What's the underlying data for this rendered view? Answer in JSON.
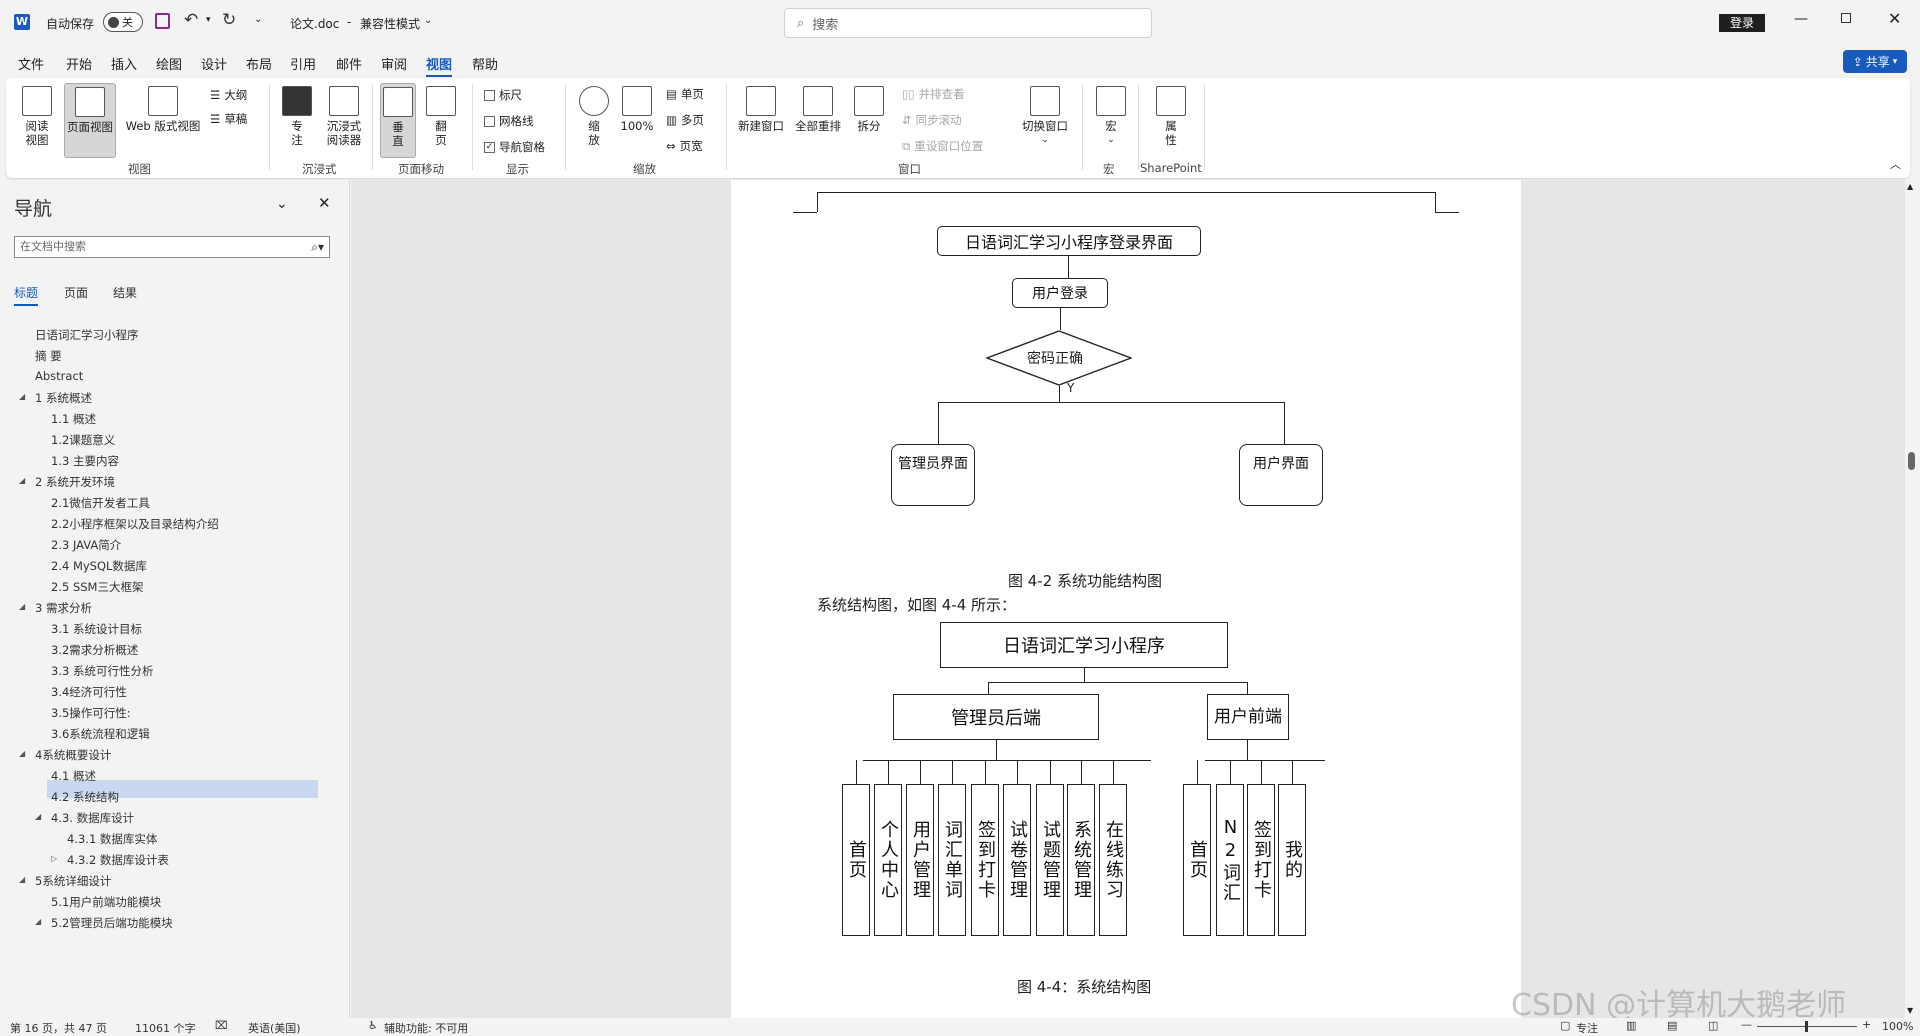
{
  "titlebar": {
    "autosave_label": "自动保存",
    "autosave_state": "关",
    "doc_title": "论文.doc",
    "separator": "-",
    "mode": "兼容性模式",
    "search_placeholder": "搜索",
    "login_label": "登录"
  },
  "menu": [
    "文件",
    "开始",
    "插入",
    "绘图",
    "设计",
    "布局",
    "引用",
    "邮件",
    "审阅",
    "视图",
    "帮助"
  ],
  "share_label": "共享",
  "ribbon": {
    "view_group": {
      "read": "阅读\n视图",
      "page": "页面视图",
      "web": "Web 版式视图",
      "outline": "大纲",
      "draft": "草稿",
      "label": "视图"
    },
    "immersive_group": {
      "focus": "专\n注",
      "reader": "沉浸式\n阅读器",
      "label": "沉浸式"
    },
    "pagemove_group": {
      "vertical": "垂\n直",
      "flip": "翻\n页",
      "label": "页面移动"
    },
    "show_group": {
      "ruler": "标尺",
      "grid": "网格线",
      "navpane": "导航窗格",
      "label": "显示"
    },
    "zoom_group": {
      "zoom": "缩\n放",
      "percent": "100%",
      "single": "单页",
      "multi": "多页",
      "width": "页宽",
      "label": "缩放"
    },
    "window_group": {
      "new": "新建窗口",
      "arrange": "全部重排",
      "split": "拆分",
      "side": "并排查看",
      "sync": "同步滚动",
      "reset": "重设窗口位置",
      "switch": "切换窗口",
      "label": "窗口"
    },
    "macro_group": {
      "macro": "宏",
      "label": "宏"
    },
    "sp_group": {
      "prop": "属\n性",
      "label": "SharePoint"
    }
  },
  "nav": {
    "title": "导航",
    "search_placeholder": "在文档中搜索",
    "tabs": [
      "标题",
      "页面",
      "结果"
    ],
    "items": [
      "日语词汇学习小程序",
      "摘 要",
      "Abstract",
      "1 系统概述",
      "1.1 概述",
      "1.2课题意义",
      "1.3 主要内容",
      "2 系统开发环境",
      "2.1微信开发者工具",
      "2.2小程序框架以及目录结构介绍",
      "2.3 JAVA简介",
      "2.4 MySQL数据库",
      "2.5 SSM三大框架",
      "3 需求分析",
      "3.1 系统设计目标",
      "3.2需求分析概述",
      "3.3 系统可行性分析",
      "3.4经济可行性",
      "3.5操作可行性:",
      "3.6系统流程和逻辑",
      "4系统概要设计",
      "4.1 概述",
      "4.2 系统结构",
      "4.3. 数据库设计",
      "4.3.1 数据库实体",
      "4.3.2 数据库设计表",
      "5系统详细设计",
      "5.1用户前端功能模块",
      "5.2管理员后端功能模块"
    ]
  },
  "doc": {
    "flow": {
      "login_page": "日语词汇学习小程序登录界面",
      "user_login": "用户登录",
      "password_ok": "密码正确",
      "yes": "Y",
      "admin_ui": "管理员界面",
      "user_ui": "用户界面",
      "caption": "图 4-2 系统功能结构图"
    },
    "intro": "系统结构图，如图 4-4 所示：",
    "structure": {
      "root": "日语词汇学习小程序",
      "admin": "管理员后端",
      "user": "用户前端",
      "admin_children": [
        "首页",
        "个人中心",
        "用户管理",
        "词汇单词",
        "签到打卡",
        "试卷管理",
        "试题管理",
        "系统管理",
        "在线练习"
      ],
      "user_children": [
        "首页",
        "N2词汇",
        "签到打卡",
        "我的"
      ],
      "caption": "图 4-4：系统结构图"
    }
  },
  "status": {
    "page": "第 16 页，共 47 页",
    "words": "11061 个字",
    "lang": "英语(美国)",
    "access": "辅助功能: 不可用",
    "focus": "专注",
    "zoom": "100%"
  },
  "watermark": "CSDN @计算机大鹅老师",
  "colors": {
    "accent": "#185abd",
    "selected": "#c7d8f0",
    "page": "#ffffff"
  }
}
